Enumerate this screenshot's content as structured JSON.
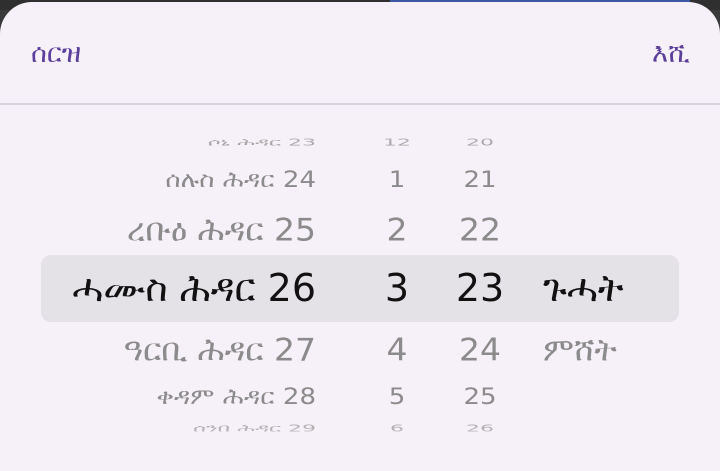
{
  "header": {
    "cancel_label": "ሰርዝ",
    "ok_label": "እሺ"
  },
  "picker": {
    "days": [
      "ሶኒ ሕዳር 23",
      "ሰሉስ ሕዳር 24",
      "ረቡዕ ሕዳር 25",
      "ሓሙስ ሕዳር 26",
      "ዓርቢ ሕዳር 27",
      "ቀዳም ሕዳር 28",
      "ሰንበ ሕዳር 29"
    ],
    "hours": [
      "12",
      "1",
      "2",
      "3",
      "4",
      "5",
      "6"
    ],
    "minutes": [
      "20",
      "21",
      "22",
      "23",
      "24",
      "25",
      "26"
    ],
    "periods": [
      "ጉሓት",
      "ምሸት"
    ],
    "selected": {
      "day": "ሓሙስ ሕዳር 26",
      "hour": "3",
      "minute": "23",
      "period": "ጉሓት"
    }
  },
  "colors": {
    "accent": "#5b3f9a",
    "sheet": "#f6f1f8",
    "selection": "#e4e1e7"
  }
}
